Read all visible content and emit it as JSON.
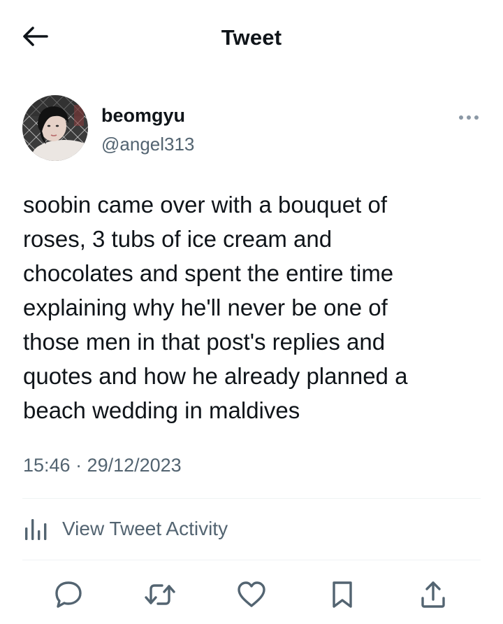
{
  "header": {
    "title": "Tweet",
    "back_icon": "arrow-left-icon"
  },
  "author": {
    "display_name": "beomgyu",
    "handle": "@angel313",
    "more_icon": "more-horizontal-icon"
  },
  "tweet": {
    "text": "soobin came over with a bouquet of\nroses, 3 tubs of ice cream and\nchocolates and spent the entire time\nexplaining why he'll never be one of\nthose men in that post's replies and\nquotes and how he already planned a\nbeach wedding in maldives",
    "timestamp": "15:46 · 29/12/2023"
  },
  "activity": {
    "label": "View Tweet Activity",
    "icon": "bar-chart-icon"
  },
  "actions": [
    {
      "name": "reply",
      "icon": "reply-icon"
    },
    {
      "name": "retweet",
      "icon": "retweet-icon"
    },
    {
      "name": "like",
      "icon": "heart-icon"
    },
    {
      "name": "bookmark",
      "icon": "bookmark-icon"
    },
    {
      "name": "share",
      "icon": "share-icon"
    }
  ],
  "colors": {
    "text_primary": "#0f1419",
    "text_secondary": "#536471",
    "divider": "#eff3f4",
    "icon": "#536471"
  }
}
